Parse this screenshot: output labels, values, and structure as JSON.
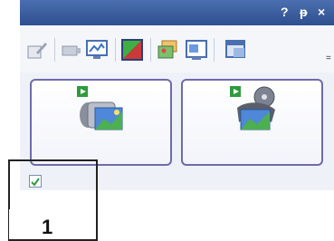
{
  "titlebar": {
    "help": "?",
    "pin": "ᵽ",
    "close": "×"
  },
  "toolbar": {
    "items": [
      {
        "name": "edit-icon"
      },
      {
        "name": "camera-icon"
      },
      {
        "name": "monitor-icon"
      },
      {
        "name": "color-swatch-icon"
      },
      {
        "name": "gallery-icon"
      },
      {
        "name": "screenshot-icon"
      },
      {
        "name": "window-icon"
      }
    ],
    "overflow": "="
  },
  "buttons": [
    {
      "name": "import-video-button",
      "icon": "video-camera-icon"
    },
    {
      "name": "import-film-button",
      "icon": "film-reel-icon"
    }
  ],
  "checkbox": {
    "checked": true,
    "mark": "✔"
  },
  "callout": {
    "number": "1"
  }
}
